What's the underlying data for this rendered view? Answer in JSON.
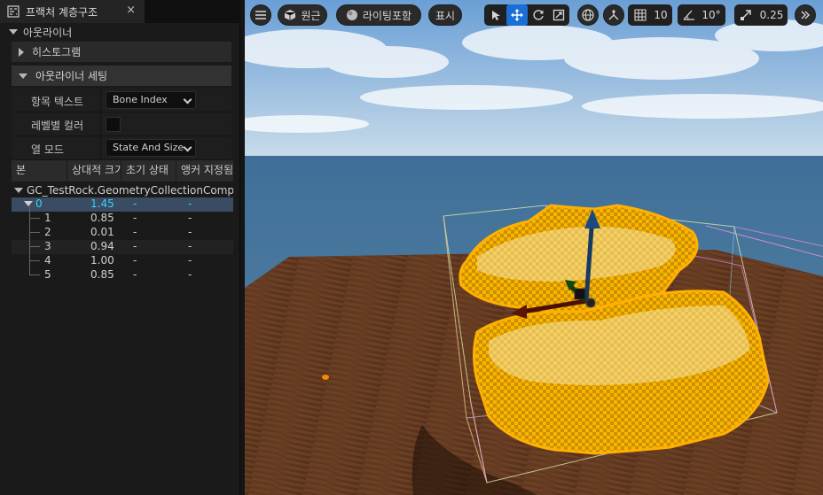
{
  "panel": {
    "title": "프랙처 계층구조",
    "close_glyph": "×",
    "icon": "hierarchy-icon"
  },
  "outliner": {
    "title": "아웃라이너",
    "histogram_label": "히스토그램",
    "settings_label": "아웃라이너 세팅",
    "props": {
      "item_text_label": "항목 텍스트",
      "item_text_value": "Bone Index",
      "level_color_label": "레벨별 컬러",
      "column_mode_label": "열 모드",
      "column_mode_value": "State And Size"
    }
  },
  "table": {
    "columns": [
      "본",
      "상대적 크기",
      "초기 상태",
      "앵커 지정됨"
    ],
    "root_label": "GC_TestRock.GeometryCollectionComponent",
    "rows": [
      {
        "bone": "0",
        "rel": "1.45",
        "init": "-",
        "anchor": "-"
      },
      {
        "bone": "1",
        "rel": "0.85",
        "init": "-",
        "anchor": "-"
      },
      {
        "bone": "2",
        "rel": "0.01",
        "init": "-",
        "anchor": "-"
      },
      {
        "bone": "3",
        "rel": "0.94",
        "init": "-",
        "anchor": "-"
      },
      {
        "bone": "4",
        "rel": "1.00",
        "init": "-",
        "anchor": "-"
      },
      {
        "bone": "5",
        "rel": "0.85",
        "init": "-",
        "anchor": "-"
      }
    ]
  },
  "viewport": {
    "perspective_label": "원근",
    "lighting_label": "라이팅포함",
    "show_label": "표시",
    "grid_snap_value": "10",
    "rotation_snap_value": "10°",
    "scale_snap_value": "0.25",
    "colors": {
      "accent": "#1a6fd6",
      "selection": "#ffc400",
      "selected_text": "#39d3ff"
    }
  }
}
